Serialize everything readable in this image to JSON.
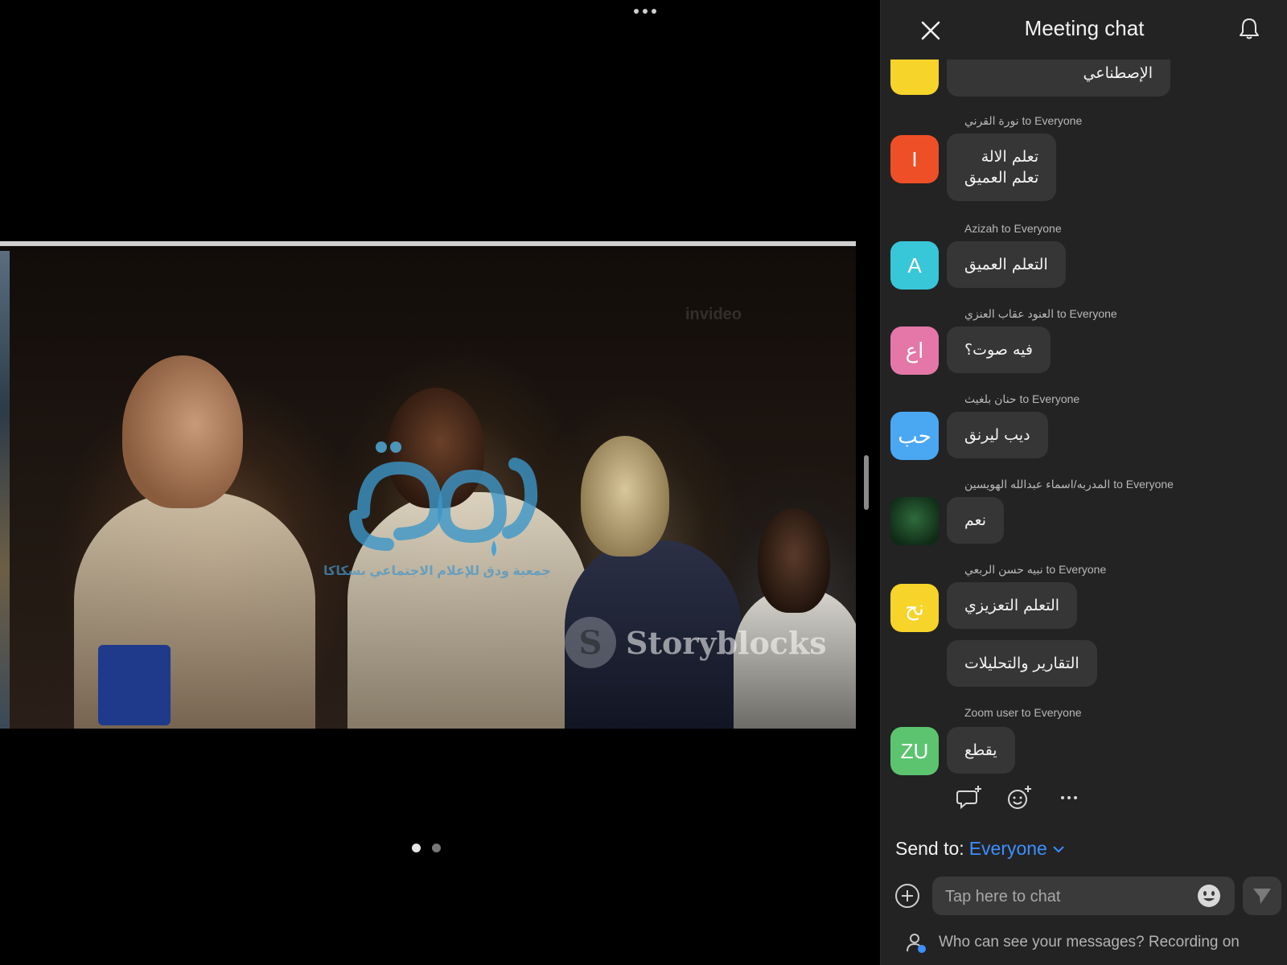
{
  "chat": {
    "title": "Meeting chat",
    "messages": [
      {
        "sender": "",
        "avatar": "",
        "avatar_color": "#f6d42a",
        "text_lines": [
          "الإصطناعي"
        ]
      },
      {
        "sender": "نورة القرني to Everyone",
        "avatar": "I",
        "avatar_color": "#ef4f26",
        "text_lines": [
          "تعلم الالة",
          "تعلم العميق"
        ]
      },
      {
        "sender": "Azizah to Everyone",
        "avatar": "A",
        "avatar_color": "#38c6d9",
        "text_lines": [
          "التعلم العميق"
        ]
      },
      {
        "sender": "العنود عقاب العنزي to Everyone",
        "avatar": "اع",
        "avatar_color": "#e477a8",
        "text_lines": [
          "فيه صوت؟"
        ]
      },
      {
        "sender": "حنان بلغيث to Everyone",
        "avatar": "حب",
        "avatar_color": "#4aa7f2",
        "text_lines": [
          "ديب ليرنق"
        ]
      },
      {
        "sender": "المدربه/اسماء عبدالله الهويسين to Everyone",
        "avatar": "",
        "avatar_color": "#1f4d2c",
        "text_lines": [
          "نعم"
        ]
      },
      {
        "sender": "نبيه حسن الربعي to Everyone",
        "avatar": "نح",
        "avatar_color": "#f6d42a",
        "text_lines": [
          "التعلم التعزيزي",
          "التقارير والتحليلات"
        ]
      },
      {
        "sender": "Zoom user to Everyone",
        "avatar": "ZU",
        "avatar_color": "#5cc46f",
        "text_lines": [
          "يقطع"
        ]
      }
    ],
    "send_to_label": "Send to:",
    "send_to_value": "Everyone",
    "input_placeholder": "Tap here to chat",
    "privacy_text": "Who can see your messages? Recording on"
  },
  "video": {
    "watermark_subtitle": "جمعية ودق للإعلام الاجتماعي بسكاكا",
    "watermark_brand": "Storyblocks",
    "watermark_faint": "invideo"
  },
  "pager": {
    "pages": 2,
    "current": 1
  },
  "icons": {
    "close": "close-icon",
    "bell": "bell-icon",
    "reply": "reply-icon",
    "emoji_add": "add-reaction-icon",
    "more": "more-icon",
    "plus": "plus-circle-icon",
    "emoji": "emoji-icon",
    "send": "send-icon",
    "chevron": "chevron-down-icon",
    "privacy": "person-lock-icon"
  },
  "colors": {
    "accent": "#3d8fff",
    "panel_bg": "#232323",
    "bubble_bg": "#363636"
  }
}
